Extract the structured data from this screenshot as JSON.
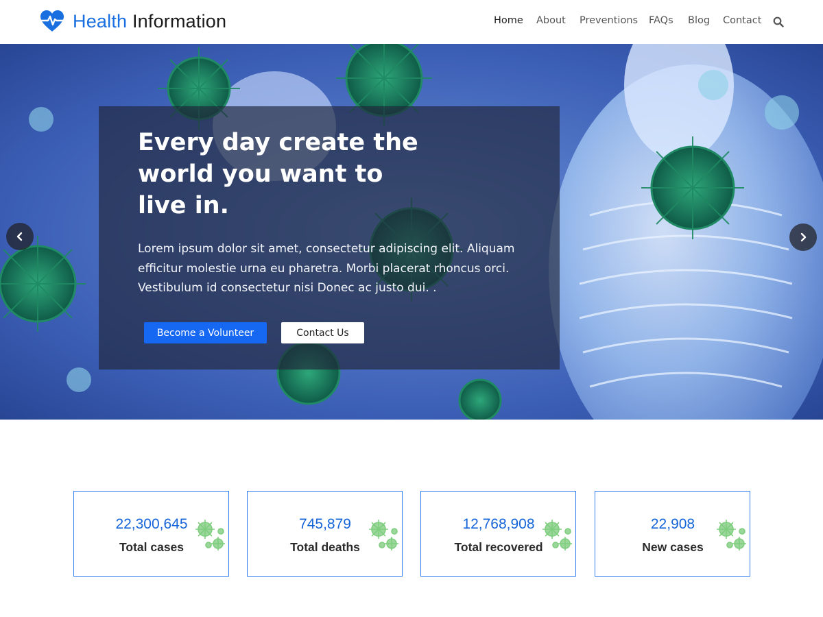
{
  "header": {
    "logo_word1": "Health",
    "logo_word2": "Information",
    "nav": [
      "Home",
      "About",
      "Preventions",
      "FAQs",
      "Blog",
      "Contact"
    ]
  },
  "hero": {
    "title": "Every day create the world you want to live in.",
    "text": "Lorem ipsum dolor sit amet, consectetur adipiscing elit. Aliquam efficitur molestie urna eu pharetra. Morbi placerat rhoncus orci. Vestibulum id consectetur nisi Donec ac justo dui. .",
    "primary_button": "Become a Volunteer",
    "secondary_button": "Contact Us"
  },
  "stats": [
    {
      "value": "22,300,645",
      "label": "Total cases"
    },
    {
      "value": "745,879",
      "label": "Total deaths"
    },
    {
      "value": "12,768,908",
      "label": "Total recovered"
    },
    {
      "value": "22,908",
      "label": "New cases"
    }
  ],
  "colors": {
    "accent": "#1667f2",
    "brand": "#1a6fe0",
    "stat_border": "#2f7df0",
    "icon_green": "#7fce7f"
  },
  "icons": [
    "heart-pulse-icon",
    "search-icon",
    "chevron-left-icon",
    "chevron-right-icon",
    "virus-icon"
  ]
}
